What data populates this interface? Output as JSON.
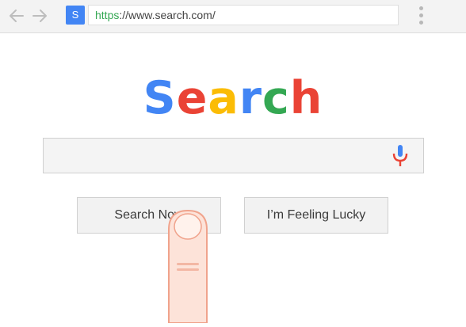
{
  "browser": {
    "favicon_letter": "S",
    "url_scheme": "https",
    "url_rest": "://www.search.com/",
    "accent_color": "#4285f4"
  },
  "logo": {
    "letters": [
      {
        "char": "S",
        "color": "#4285f4"
      },
      {
        "char": "e",
        "color": "#ea4335"
      },
      {
        "char": "a",
        "color": "#fbbc05"
      },
      {
        "char": "r",
        "color": "#4285f4"
      },
      {
        "char": "c",
        "color": "#34a853"
      },
      {
        "char": "h",
        "color": "#ea4335"
      }
    ]
  },
  "search": {
    "value": "",
    "placeholder": "",
    "mic_icon": "microphone-icon"
  },
  "buttons": {
    "search_label": "Search Now",
    "lucky_label": "I’m Feeling Lucky"
  }
}
